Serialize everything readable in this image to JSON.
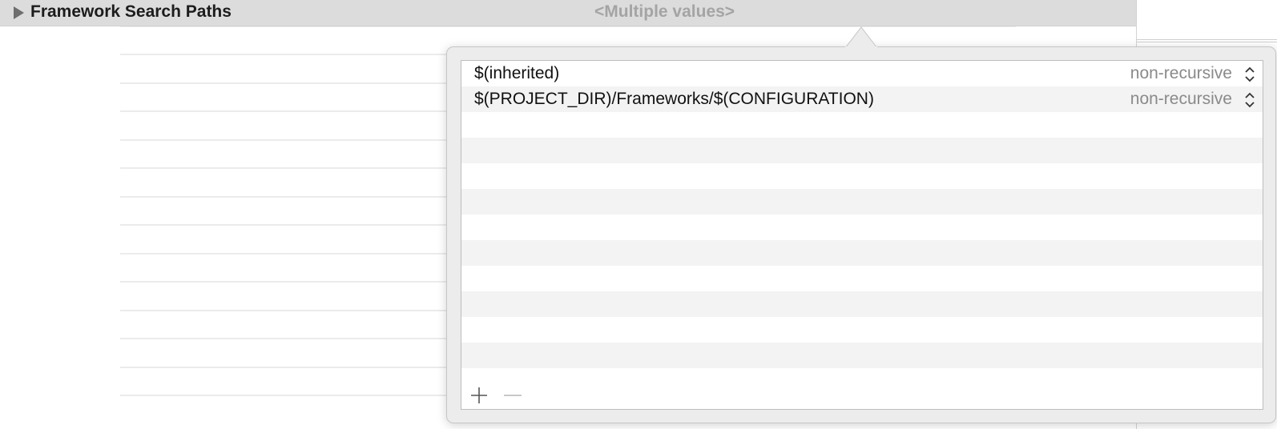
{
  "setting": {
    "name": "Framework Search Paths",
    "value": "<Multiple values>"
  },
  "popover": {
    "entries": [
      {
        "path": "$(inherited)",
        "recursion": "non-recursive"
      },
      {
        "path": "$(PROJECT_DIR)/Frameworks/$(CONFIGURATION)",
        "recursion": "non-recursive"
      }
    ],
    "empty_row_count": 10,
    "add_icon": "plus-icon",
    "remove_icon": "minus-icon"
  },
  "colors": {
    "row_header_bg": "#dcdcdc",
    "value_placeholder": "#a4a4a4",
    "popover_bg": "#ececec",
    "alt_row": "#f3f3f3",
    "recursion_text": "#8a8a8a"
  }
}
